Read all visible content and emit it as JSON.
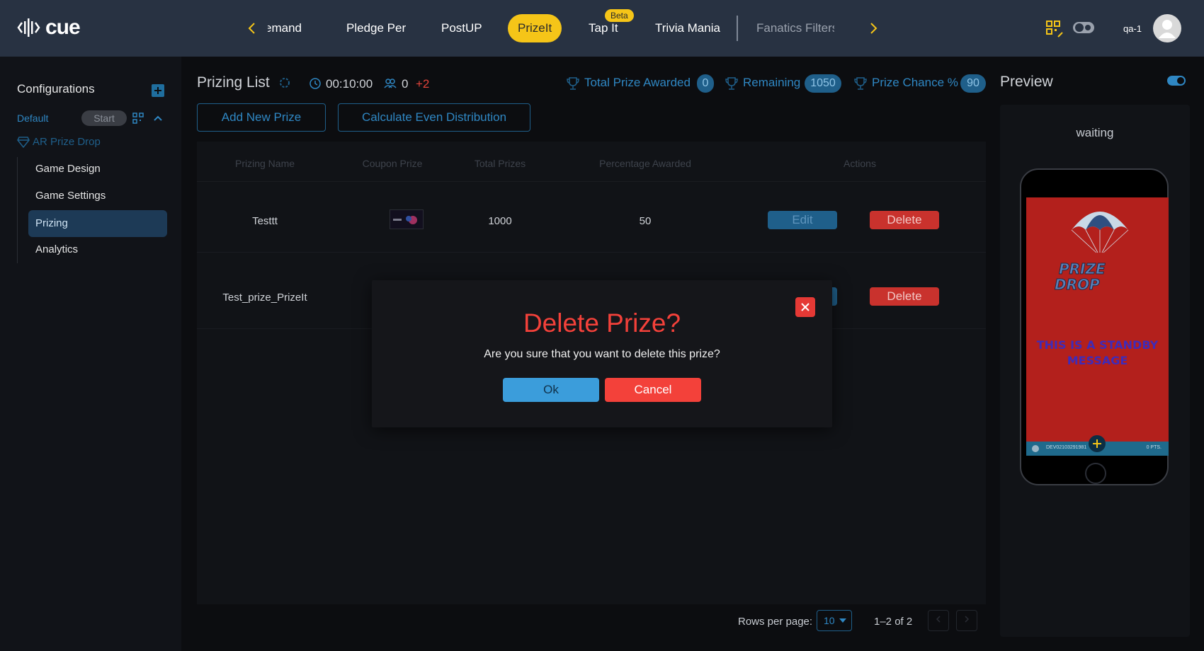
{
  "app": {
    "logo_text": "cue",
    "user_name": "qa-1"
  },
  "nav": {
    "tabs": [
      {
        "label": "Demand",
        "display": "emand"
      },
      {
        "label": "Pledge Per"
      },
      {
        "label": "PostUP"
      },
      {
        "label": "PrizeIt",
        "active": true
      },
      {
        "label": "Tap It",
        "badge": "Beta"
      },
      {
        "label": "Trivia Mania"
      },
      {
        "label": "Fanatics Filters"
      }
    ]
  },
  "sidebar": {
    "title": "Configurations",
    "config_name": "Default",
    "start_label": "Start",
    "game_name": "AR Prize Drop",
    "items": [
      {
        "label": "Game Design"
      },
      {
        "label": "Game Settings"
      },
      {
        "label": "Prizing",
        "active": true
      },
      {
        "label": "Analytics"
      }
    ]
  },
  "main": {
    "title": "Prizing List",
    "timer": "00:10:00",
    "players": "0",
    "players_delta": "+2",
    "stats": {
      "total_awarded_label": "Total Prize Awarded",
      "total_awarded_value": "0",
      "remaining_label": "Remaining",
      "remaining_value": "1050",
      "chance_label": "Prize Chance %",
      "chance_value": "90"
    },
    "buttons": {
      "add": "Add New Prize",
      "calc": "Calculate Even Distribution"
    },
    "table": {
      "headers": [
        "Prizing Name",
        "Coupon Prize",
        "Total Prizes",
        "Percentage Awarded",
        "Actions"
      ],
      "rows": [
        {
          "name": "Testtt",
          "total": "1000",
          "percent": "50",
          "edit": "Edit",
          "delete": "Delete"
        },
        {
          "name": "Test_prize_PrizeIt",
          "edit": "Edit",
          "edit_visible": "dit",
          "delete": "Delete"
        }
      ]
    },
    "pagination": {
      "rows_label": "Rows per page:",
      "rows_value": "10",
      "range": "1–2 of 2"
    }
  },
  "preview": {
    "title": "Preview",
    "status": "waiting",
    "phone": {
      "logo_line1": "PRIZE",
      "logo_line2": "DROP",
      "message": "THIS IS A STANDBY MESSAGE",
      "footer_id": "DEV02103291981",
      "footer_pts": "0 PTS."
    }
  },
  "modal": {
    "title": "Delete Prize?",
    "text": "Are you sure that you want to delete this prize?",
    "ok": "Ok",
    "cancel": "Cancel"
  },
  "colors": {
    "topbar": "#283242",
    "accent_yellow": "#f5c518",
    "accent_blue": "#2f87c3",
    "danger": "#f3413a"
  }
}
